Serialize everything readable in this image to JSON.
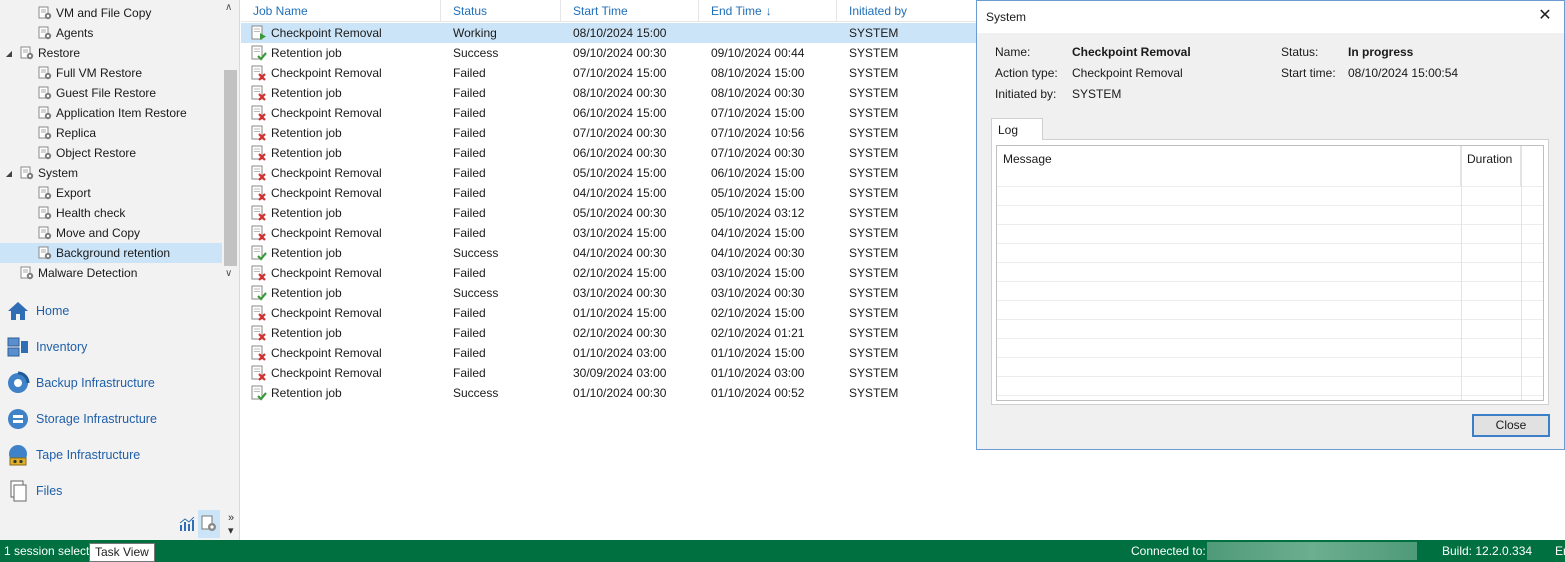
{
  "tree": {
    "items": [
      {
        "label": "VM and File Copy",
        "level": 2,
        "expander": ""
      },
      {
        "label": "Agents",
        "level": 2,
        "expander": ""
      },
      {
        "label": "Restore",
        "level": 1,
        "expander": "◢"
      },
      {
        "label": "Full VM Restore",
        "level": 2,
        "expander": ""
      },
      {
        "label": "Guest File Restore",
        "level": 2,
        "expander": ""
      },
      {
        "label": "Application Item Restore",
        "level": 2,
        "expander": ""
      },
      {
        "label": "Replica",
        "level": 2,
        "expander": ""
      },
      {
        "label": "Object Restore",
        "level": 2,
        "expander": ""
      },
      {
        "label": "System",
        "level": 1,
        "expander": "◢"
      },
      {
        "label": "Export",
        "level": 2,
        "expander": ""
      },
      {
        "label": "Health check",
        "level": 2,
        "expander": ""
      },
      {
        "label": "Move and Copy",
        "level": 2,
        "expander": ""
      },
      {
        "label": "Background retention",
        "level": 2,
        "expander": "",
        "selected": true
      },
      {
        "label": "Malware Detection",
        "level": 1,
        "expander": ""
      }
    ]
  },
  "nav": {
    "items": [
      {
        "label": "Home",
        "icon": "home-icon"
      },
      {
        "label": "Inventory",
        "icon": "inventory-icon"
      },
      {
        "label": "Backup Infrastructure",
        "icon": "backup-infrastructure-icon"
      },
      {
        "label": "Storage Infrastructure",
        "icon": "storage-infrastructure-icon"
      },
      {
        "label": "Tape Infrastructure",
        "icon": "tape-infrastructure-icon"
      },
      {
        "label": "Files",
        "icon": "files-icon"
      }
    ]
  },
  "job_list": {
    "columns": [
      {
        "label": "Job Name"
      },
      {
        "label": "Status"
      },
      {
        "label": "Start Time"
      },
      {
        "label": "End Time",
        "sort_arrow": "↓"
      },
      {
        "label": "Initiated by"
      }
    ],
    "rows": [
      {
        "name": "Checkpoint Removal",
        "status": "Working",
        "start": "08/10/2024 15:00",
        "end": "",
        "by": "SYSTEM",
        "icon": "working",
        "selected": true
      },
      {
        "name": "Retention job",
        "status": "Success",
        "start": "09/10/2024 00:30",
        "end": "09/10/2024 00:44",
        "by": "SYSTEM",
        "icon": "success"
      },
      {
        "name": "Checkpoint Removal",
        "status": "Failed",
        "start": "07/10/2024 15:00",
        "end": "08/10/2024 15:00",
        "by": "SYSTEM",
        "icon": "failed"
      },
      {
        "name": "Retention job",
        "status": "Failed",
        "start": "08/10/2024 00:30",
        "end": "08/10/2024 00:30",
        "by": "SYSTEM",
        "icon": "failed"
      },
      {
        "name": "Checkpoint Removal",
        "status": "Failed",
        "start": "06/10/2024 15:00",
        "end": "07/10/2024 15:00",
        "by": "SYSTEM",
        "icon": "failed"
      },
      {
        "name": "Retention job",
        "status": "Failed",
        "start": "07/10/2024 00:30",
        "end": "07/10/2024 10:56",
        "by": "SYSTEM",
        "icon": "failed"
      },
      {
        "name": "Retention job",
        "status": "Failed",
        "start": "06/10/2024 00:30",
        "end": "07/10/2024 00:30",
        "by": "SYSTEM",
        "icon": "failed"
      },
      {
        "name": "Checkpoint Removal",
        "status": "Failed",
        "start": "05/10/2024 15:00",
        "end": "06/10/2024 15:00",
        "by": "SYSTEM",
        "icon": "failed"
      },
      {
        "name": "Checkpoint Removal",
        "status": "Failed",
        "start": "04/10/2024 15:00",
        "end": "05/10/2024 15:00",
        "by": "SYSTEM",
        "icon": "failed"
      },
      {
        "name": "Retention job",
        "status": "Failed",
        "start": "05/10/2024 00:30",
        "end": "05/10/2024 03:12",
        "by": "SYSTEM",
        "icon": "failed"
      },
      {
        "name": "Checkpoint Removal",
        "status": "Failed",
        "start": "03/10/2024 15:00",
        "end": "04/10/2024 15:00",
        "by": "SYSTEM",
        "icon": "failed"
      },
      {
        "name": "Retention job",
        "status": "Success",
        "start": "04/10/2024 00:30",
        "end": "04/10/2024 00:30",
        "by": "SYSTEM",
        "icon": "success"
      },
      {
        "name": "Checkpoint Removal",
        "status": "Failed",
        "start": "02/10/2024 15:00",
        "end": "03/10/2024 15:00",
        "by": "SYSTEM",
        "icon": "failed"
      },
      {
        "name": "Retention job",
        "status": "Success",
        "start": "03/10/2024 00:30",
        "end": "03/10/2024 00:30",
        "by": "SYSTEM",
        "icon": "success"
      },
      {
        "name": "Checkpoint Removal",
        "status": "Failed",
        "start": "01/10/2024 15:00",
        "end": "02/10/2024 15:00",
        "by": "SYSTEM",
        "icon": "failed"
      },
      {
        "name": "Retention job",
        "status": "Failed",
        "start": "02/10/2024 00:30",
        "end": "02/10/2024 01:21",
        "by": "SYSTEM",
        "icon": "failed"
      },
      {
        "name": "Checkpoint Removal",
        "status": "Failed",
        "start": "01/10/2024 03:00",
        "end": "01/10/2024 15:00",
        "by": "SYSTEM",
        "icon": "failed"
      },
      {
        "name": "Checkpoint Removal",
        "status": "Failed",
        "start": "30/09/2024 03:00",
        "end": "01/10/2024 03:00",
        "by": "SYSTEM",
        "icon": "failed"
      },
      {
        "name": "Retention job",
        "status": "Success",
        "start": "01/10/2024 00:30",
        "end": "01/10/2024 00:52",
        "by": "SYSTEM",
        "icon": "success"
      }
    ]
  },
  "dialog": {
    "title": "System",
    "name_label": "Name:",
    "name_value": "Checkpoint Removal",
    "action_label": "Action type:",
    "action_value": "Checkpoint Removal",
    "initiated_label": "Initiated by:",
    "initiated_value": "SYSTEM",
    "status_label": "Status:",
    "status_value": "In progress",
    "start_label": "Start time:",
    "start_value": "08/10/2024 15:00:54",
    "tab_log": "Log",
    "col_message": "Message",
    "col_duration": "Duration",
    "close_label": "Close"
  },
  "status_bar": {
    "selection": "1 session selecte",
    "tooltip": "Task View",
    "connected": "Connected to:",
    "build": "Build: 12.2.0.334",
    "edge": "Er"
  },
  "colors": {
    "accent": "#1f6fb8",
    "selection": "#cce4f7",
    "status_bar": "#007040",
    "success": "#3a9a3a",
    "failed": "#d32f2f"
  }
}
